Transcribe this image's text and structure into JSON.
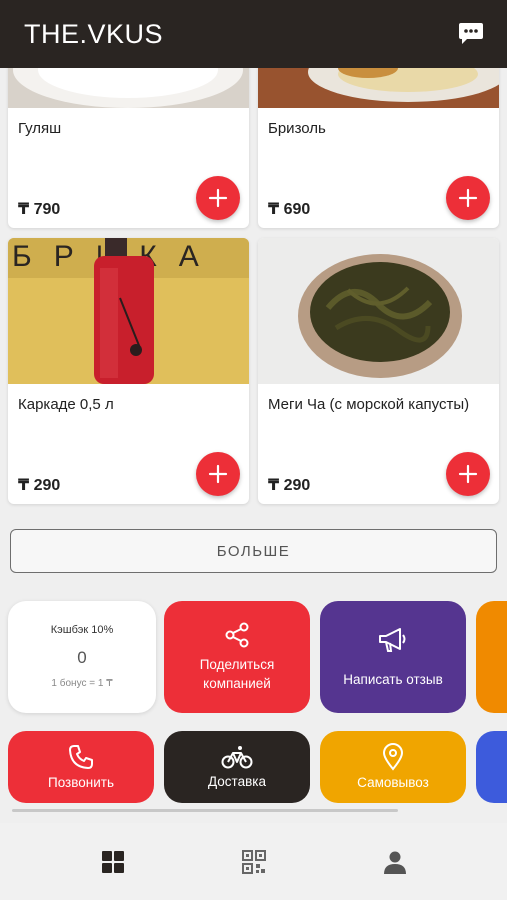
{
  "header": {
    "brand": "THE.VKUS",
    "chat_icon": "chat-bubble-icon"
  },
  "products": [
    {
      "name": "Гуляш",
      "price": "₸ 790"
    },
    {
      "name": "Бризоль",
      "price": "₸ 690"
    },
    {
      "name": "Каркаде 0,5 л",
      "price": "₸ 290",
      "image_text": "БРИКА"
    },
    {
      "name": "Меги Ча (с морской капусты)",
      "price": "₸ 290"
    }
  ],
  "more_button": "БОЛЬШЕ",
  "cashback": {
    "title": "Кэшбэк 10%",
    "value": "0",
    "note": "1 бонус = 1 ₸"
  },
  "tiles": {
    "share": "Поделиться компанией",
    "review": "Написать отзыв",
    "call": "Позвонить",
    "delivery": "Доставка",
    "pickup": "Самовывоз"
  },
  "colors": {
    "header": "#2a2522",
    "accent_red": "#ed2f38",
    "purple": "#553590",
    "dark": "#2a2522",
    "amber": "#f0a500",
    "orange": "#f08a00",
    "blue": "#3d5bdc"
  },
  "bottom_nav": [
    "grid-icon",
    "qr-code-icon",
    "user-icon"
  ]
}
